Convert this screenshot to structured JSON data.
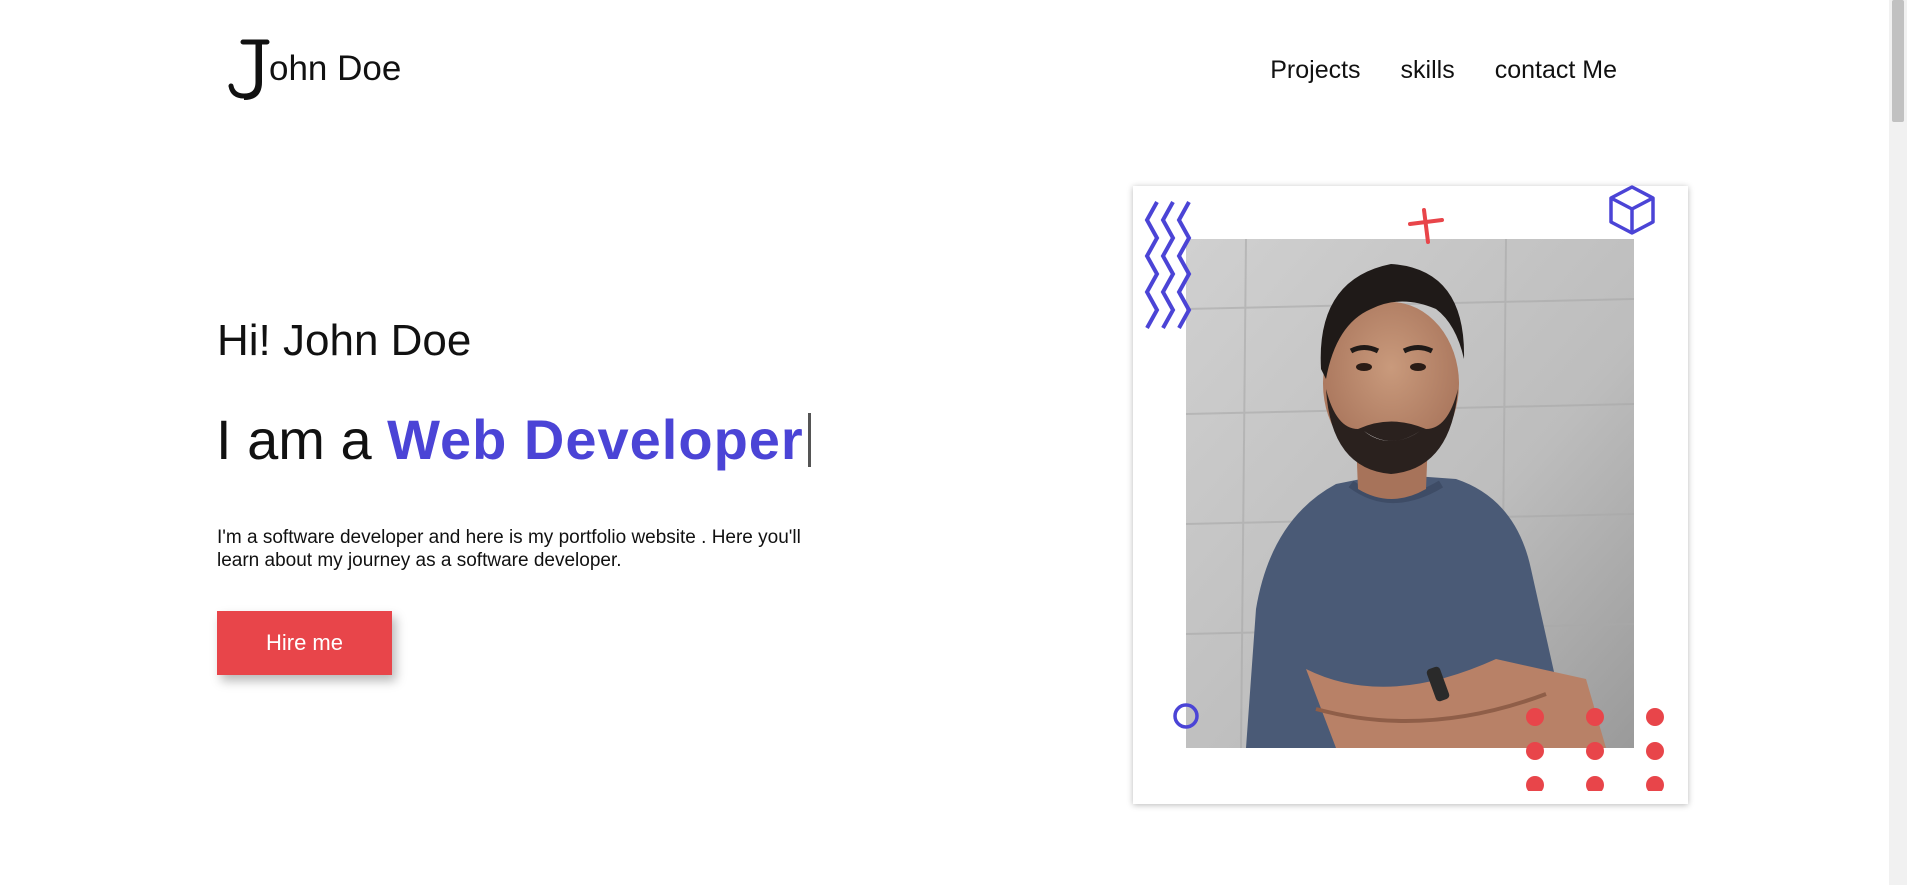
{
  "header": {
    "logo_initial": "J",
    "logo_rest": "ohn Doe",
    "nav": [
      "Projects",
      "skills",
      "contact Me"
    ]
  },
  "hero": {
    "greeting": "Hi! John Doe",
    "role_prefix": "I am a ",
    "role_highlight": "Web Developer",
    "description": "I'm a software developer and here is my portfolio website . Here you'll learn about my journey as a software developer.",
    "cta_label": "Hire me"
  },
  "colors": {
    "accent": "#4b44d6",
    "cta": "#e8454a",
    "text": "#111111"
  }
}
